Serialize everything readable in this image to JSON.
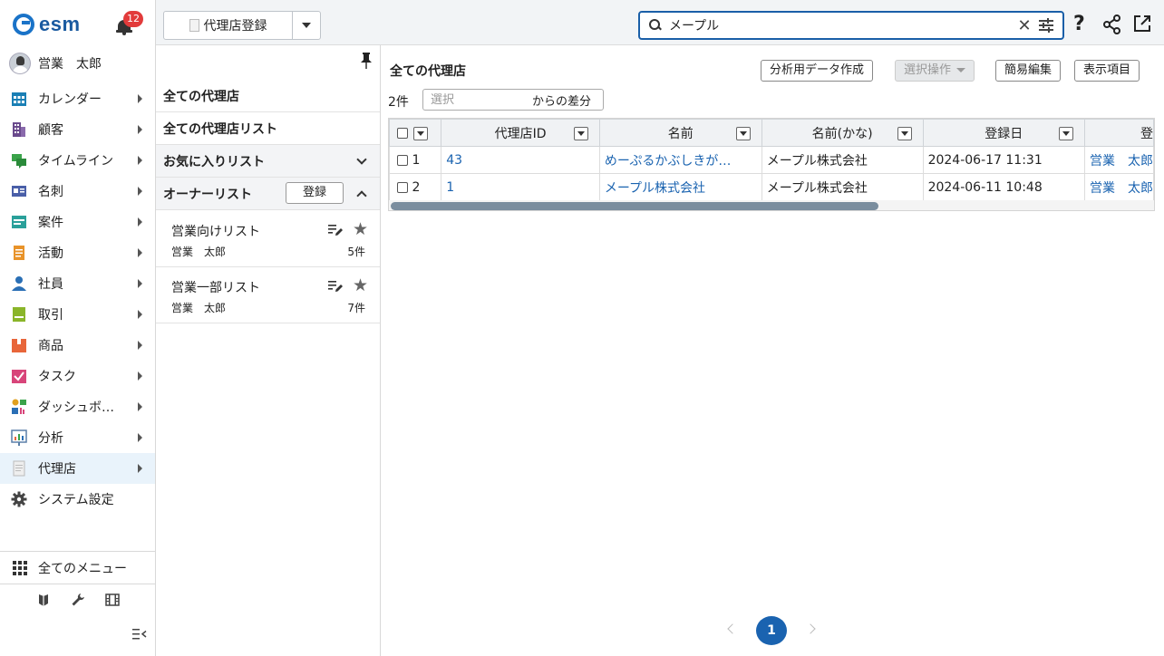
{
  "app": {
    "logo_text": "esm",
    "notification_count": "12"
  },
  "user": {
    "name": "営業　太郎"
  },
  "sidebar": {
    "items": [
      {
        "label": "カレンダー",
        "icon": "calendar-icon",
        "color": "#1a7fb5"
      },
      {
        "label": "顧客",
        "icon": "building-icon",
        "color": "#6a4a8c"
      },
      {
        "label": "タイムライン",
        "icon": "chat-icon",
        "color": "#3aa34a"
      },
      {
        "label": "名刺",
        "icon": "business-card-icon",
        "color": "#4a5fa8"
      },
      {
        "label": "案件",
        "icon": "folder-icon",
        "color": "#2aa09a"
      },
      {
        "label": "活動",
        "icon": "clipboard-icon",
        "color": "#e8932a"
      },
      {
        "label": "社員",
        "icon": "person-icon",
        "color": "#2a6fb5"
      },
      {
        "label": "取引",
        "icon": "ledger-icon",
        "color": "#8ab52a"
      },
      {
        "label": "商品",
        "icon": "box-icon",
        "color": "#e8663a"
      },
      {
        "label": "タスク",
        "icon": "checklist-icon",
        "color": "#d8457a"
      },
      {
        "label": "ダッシュボ…",
        "icon": "dashboard-icon",
        "color": "#e0a020"
      },
      {
        "label": "分析",
        "icon": "bar-chart-icon",
        "color": "#5a7fa8"
      },
      {
        "label": "代理店",
        "icon": "document-icon",
        "color": "#bbbbbb"
      },
      {
        "label": "システム設定",
        "icon": "gear-icon",
        "color": "#444444"
      }
    ],
    "all_menu_label": "全てのメニュー"
  },
  "topbar": {
    "new_button_label": "代理店登録",
    "search_value": "メープル"
  },
  "listpanel": {
    "all_label": "全ての代理店",
    "all_list_label": "全ての代理店リスト",
    "favorites_label": "お気に入りリスト",
    "owner_label": "オーナーリスト",
    "register_label": "登録",
    "lists": [
      {
        "name": "営業向けリスト",
        "owner": "営業　太郎",
        "count": "5件"
      },
      {
        "name": "営業一部リスト",
        "owner": "営業　太郎",
        "count": "7件"
      }
    ]
  },
  "main": {
    "title": "全ての代理店",
    "buttons": {
      "analysis": "分析用データ作成",
      "select_ops": "選択操作",
      "quick_edit": "簡易編集",
      "display_items": "表示項目"
    },
    "count": "2件",
    "diff_placeholder": "選択",
    "diff_suffix": "からの差分",
    "table": {
      "headers": [
        "代理店ID",
        "名前",
        "名前(かな)",
        "登録日",
        "登"
      ],
      "rows": [
        {
          "num": "1",
          "id": "43",
          "name": "めーぷるかぶしきが…",
          "kana": "メープル株式会社",
          "date": "2024-06-17 11:31",
          "reg": "営業　太郎"
        },
        {
          "num": "2",
          "id": "1",
          "name": "メープル株式会社",
          "kana": "メープル株式会社",
          "date": "2024-06-11 10:48",
          "reg": "営業　太郎"
        }
      ]
    },
    "pagination": {
      "current": "1"
    }
  }
}
